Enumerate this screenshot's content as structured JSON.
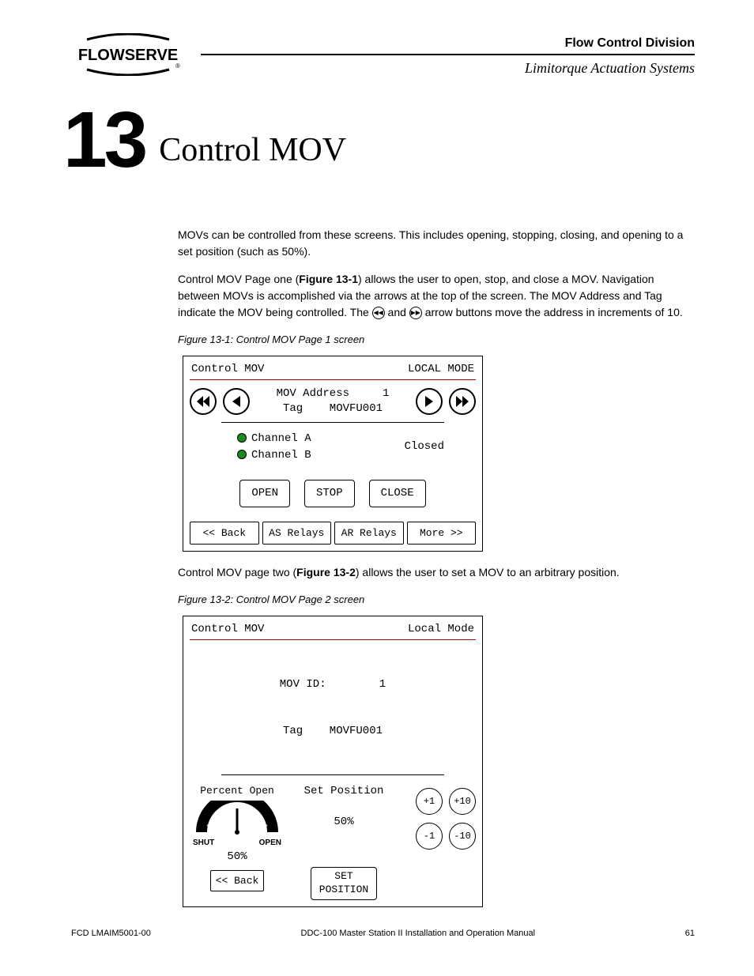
{
  "header": {
    "logo_text": "FLOWSERVE",
    "division": "Flow Control Division",
    "subtitle": "Limitorque Actuation Systems"
  },
  "chapter": {
    "number": "13",
    "title": "Control MOV"
  },
  "para1": "MOVs can be controlled from these screens. This includes opening, stopping, closing, and opening to a set position (such as 50%).",
  "para2a": "Control MOV Page one (",
  "para2b": "Figure 13-1",
  "para2c": ") allows the user to open, stop, and close a MOV. Navigation between MOVs is accomplished via the arrows at the top of the screen. The MOV Address and Tag indicate the MOV being controlled. The ",
  "para2d": " and ",
  "para2e": " arrow buttons move the address in increments of 10.",
  "fig1": "Figure 13-1: Control MOV Page 1 screen",
  "screen1": {
    "title": "Control MOV",
    "mode": "LOCAL MODE",
    "addr_label": "MOV Address     1",
    "tag_label": "Tag    MOVFU001",
    "ch_a": "Channel A",
    "ch_b": "Channel B",
    "state": "Closed",
    "open": "OPEN",
    "stop": "STOP",
    "close": "CLOSE",
    "back": "<< Back",
    "as": "AS Relays",
    "ar": "AR Relays",
    "more": "More >>"
  },
  "para3a": "Control MOV page two (",
  "para3b": "Figure 13-2",
  "para3c": ") allows the user to set a MOV to an arbitrary position.",
  "fig2": "Figure 13-2: Control MOV Page 2 screen",
  "screen2": {
    "title": "Control MOV",
    "mode": "Local Mode",
    "id_label": "MOV ID:        1",
    "tag_label": "Tag    MOVFU001",
    "percent_label": "Percent Open",
    "shut": "SHUT",
    "open": "OPEN",
    "percent_val": "50%",
    "back": "<< Back",
    "set_pos_label": "Set Position",
    "set_pos_val": "50%",
    "set_btn_l1": "SET",
    "set_btn_l2": "POSITION",
    "p1": "+1",
    "p10": "+10",
    "m1": "-1",
    "m10": "-10"
  },
  "footer": {
    "left": "FCD LMAIM5001-00",
    "center": "DDC-100 Master Station II Installation and Operation Manual",
    "right": "61"
  }
}
